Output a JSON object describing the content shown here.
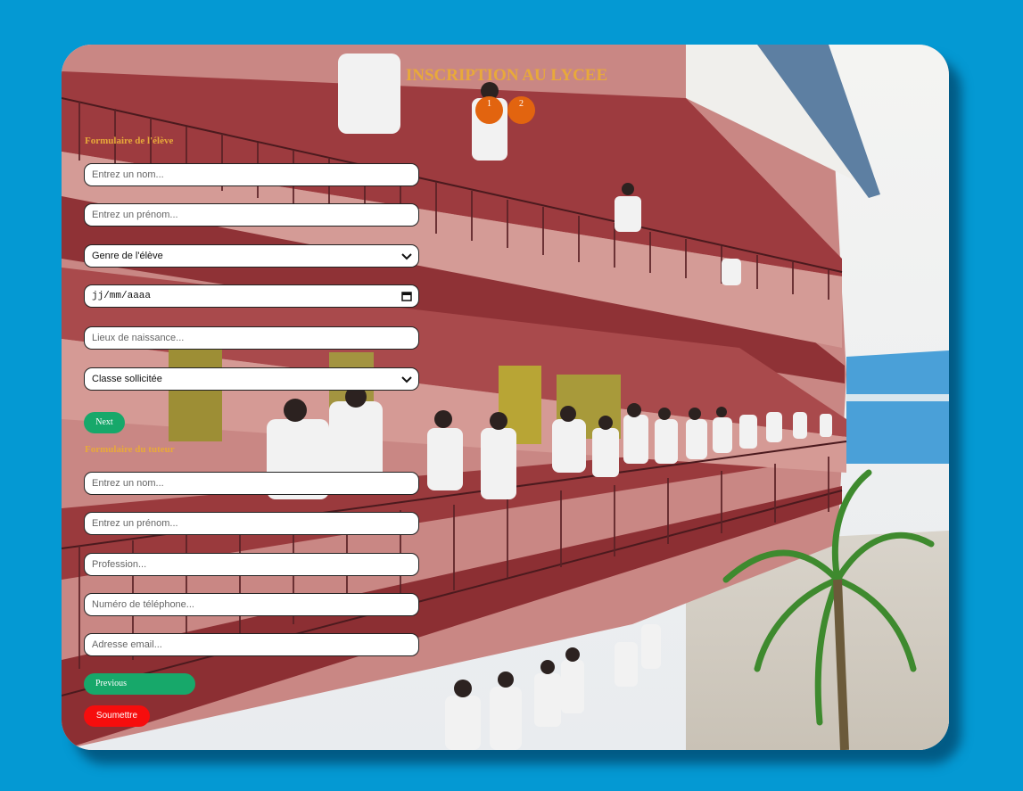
{
  "title": "INSCRIPTION AU LYCEE",
  "steps": [
    "1",
    "2"
  ],
  "student_form": {
    "heading": "Formulaire de l'élève",
    "name_placeholder": "Entrez un nom...",
    "firstname_placeholder": "Entrez un prénom...",
    "gender_selected": "Genre de l'élève",
    "birthdate_placeholder": "jj/mm/aaaa",
    "birthplace_placeholder": "Lieux de naissance...",
    "class_selected": "Classe sollicitée",
    "next_label": "Next"
  },
  "tutor_form": {
    "heading": "Formulaire du tuteur",
    "name_placeholder": "Entrez un nom...",
    "firstname_placeholder": "Entrez un prénom...",
    "profession_placeholder": "Profession...",
    "phone_placeholder": "Numéro de téléphone...",
    "email_placeholder": "Adresse email...",
    "previous_label": "Previous",
    "submit_label": "Soumettre"
  },
  "colors": {
    "page_background": "#0499d3",
    "title": "#e8a93a",
    "step_circle": "#e2640f",
    "next_button": "#17a86a",
    "submit_button": "#f60d0d"
  }
}
